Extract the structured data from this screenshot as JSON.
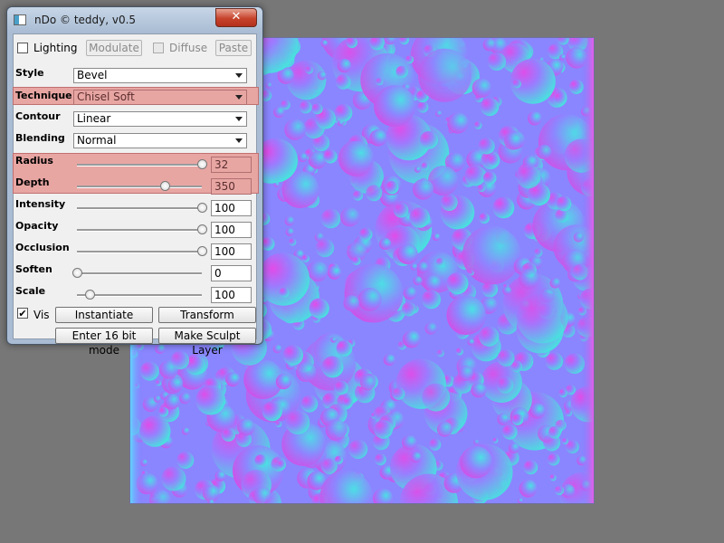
{
  "window": {
    "title": "nDo © teddy, v0.5",
    "close_label": "✕"
  },
  "top_row": {
    "lighting_label": "Lighting",
    "lighting_checked": false,
    "modulate_label": "Modulate",
    "diffuse_label": "Diffuse",
    "diffuse_checked": false,
    "paste_label": "Paste"
  },
  "dropdowns": [
    {
      "label": "Style",
      "value": "Bevel",
      "highlighted": false
    },
    {
      "label": "Technique",
      "value": "Chisel Soft",
      "highlighted": true
    },
    {
      "label": "Contour",
      "value": "Linear",
      "highlighted": false
    },
    {
      "label": "Blending",
      "value": "Normal",
      "highlighted": false
    }
  ],
  "sliders": [
    {
      "label": "Radius",
      "value": "32",
      "level": 1.0,
      "highlighted": true
    },
    {
      "label": "Depth",
      "value": "350",
      "level": 0.7,
      "highlighted": true
    },
    {
      "label": "Intensity",
      "value": "100",
      "level": 1.0,
      "highlighted": false
    },
    {
      "label": "Opacity",
      "value": "100",
      "level": 1.0,
      "highlighted": false
    },
    {
      "label": "Occlusion",
      "value": "100",
      "level": 1.0,
      "highlighted": false
    },
    {
      "label": "Soften",
      "value": "0",
      "level": 0.0,
      "highlighted": false
    },
    {
      "label": "Scale",
      "value": "100",
      "level": 0.1,
      "highlighted": false
    }
  ],
  "bottom": {
    "vis_label": "Vis",
    "vis_checked": true,
    "vis_mark": "✔",
    "instantiate_label": "Instantiate",
    "transform_label": "Transform",
    "enter16_label": "Enter 16 bit mode",
    "sculpt_label": "Make Sculpt Layer"
  },
  "colors": {
    "background": "#777777",
    "normal_map_base": "#8080ff",
    "normal_map_magenta": "#e040e8",
    "normal_map_cyan": "#40e8e0",
    "highlight": "#e8a6a3"
  },
  "icons": [
    "app-icon",
    "close-icon",
    "dropdown-arrow-icon",
    "checkmark-icon"
  ]
}
